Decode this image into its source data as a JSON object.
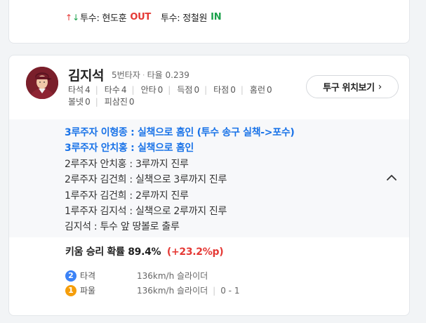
{
  "substitution": {
    "out_role": "투수:",
    "out_player": "현도훈",
    "out_tag": "OUT",
    "in_role": "투수:",
    "in_player": "정철원",
    "in_tag": "IN",
    "colors": {
      "up": "#e53935",
      "down": "#1aa14b"
    }
  },
  "batter": {
    "name": "김지석",
    "order": "5번타자",
    "avg_label": "타율",
    "avg": "0.239",
    "stats": [
      {
        "label": "타석",
        "value": "4"
      },
      {
        "label": "타수",
        "value": "4"
      },
      {
        "label": "안타",
        "value": "0"
      },
      {
        "label": "득점",
        "value": "0"
      },
      {
        "label": "타점",
        "value": "0"
      },
      {
        "label": "홈런",
        "value": "0"
      },
      {
        "label": "볼넷",
        "value": "0"
      },
      {
        "label": "피삼진",
        "value": "0"
      }
    ],
    "pitch_location_button": "투구 위치보기"
  },
  "events": [
    {
      "text": "3루주자 이형종 : 실책으로 홈인 (투수 송구 실책->포수)",
      "highlight": true
    },
    {
      "text": "3루주자 안치홍 : 실책으로 홈인",
      "highlight": true
    },
    {
      "text": "2루주자 안치홍 : 3루까지 진루",
      "highlight": false
    },
    {
      "text": "2루주자 김건희 : 실책으로 3루까지 진루",
      "highlight": false
    },
    {
      "text": "1루주자 김건희 : 2루까지 진루",
      "highlight": false
    },
    {
      "text": "1루주자 김지석 : 실책으로 2루까지 진루",
      "highlight": false
    },
    {
      "text": "김지석 : 투수 앞 땅볼로 출루",
      "highlight": false
    }
  ],
  "win_probability": {
    "label": "키움 승리 확률",
    "value": "89.4%",
    "delta": "(+23.2%p)"
  },
  "pitches": [
    {
      "number": "2",
      "result": "타격",
      "speed": "136km/h 슬라이더",
      "count": "",
      "color": "#3b82f6"
    },
    {
      "number": "1",
      "result": "파울",
      "speed": "136km/h 슬라이더",
      "count": "0 - 1",
      "color": "#f59e0b"
    }
  ],
  "colors": {
    "highlight_text": "#1a73e8",
    "delta_red": "#e53935",
    "in_green": "#1aa14b",
    "avatar_jersey": "#7a1f2b"
  }
}
